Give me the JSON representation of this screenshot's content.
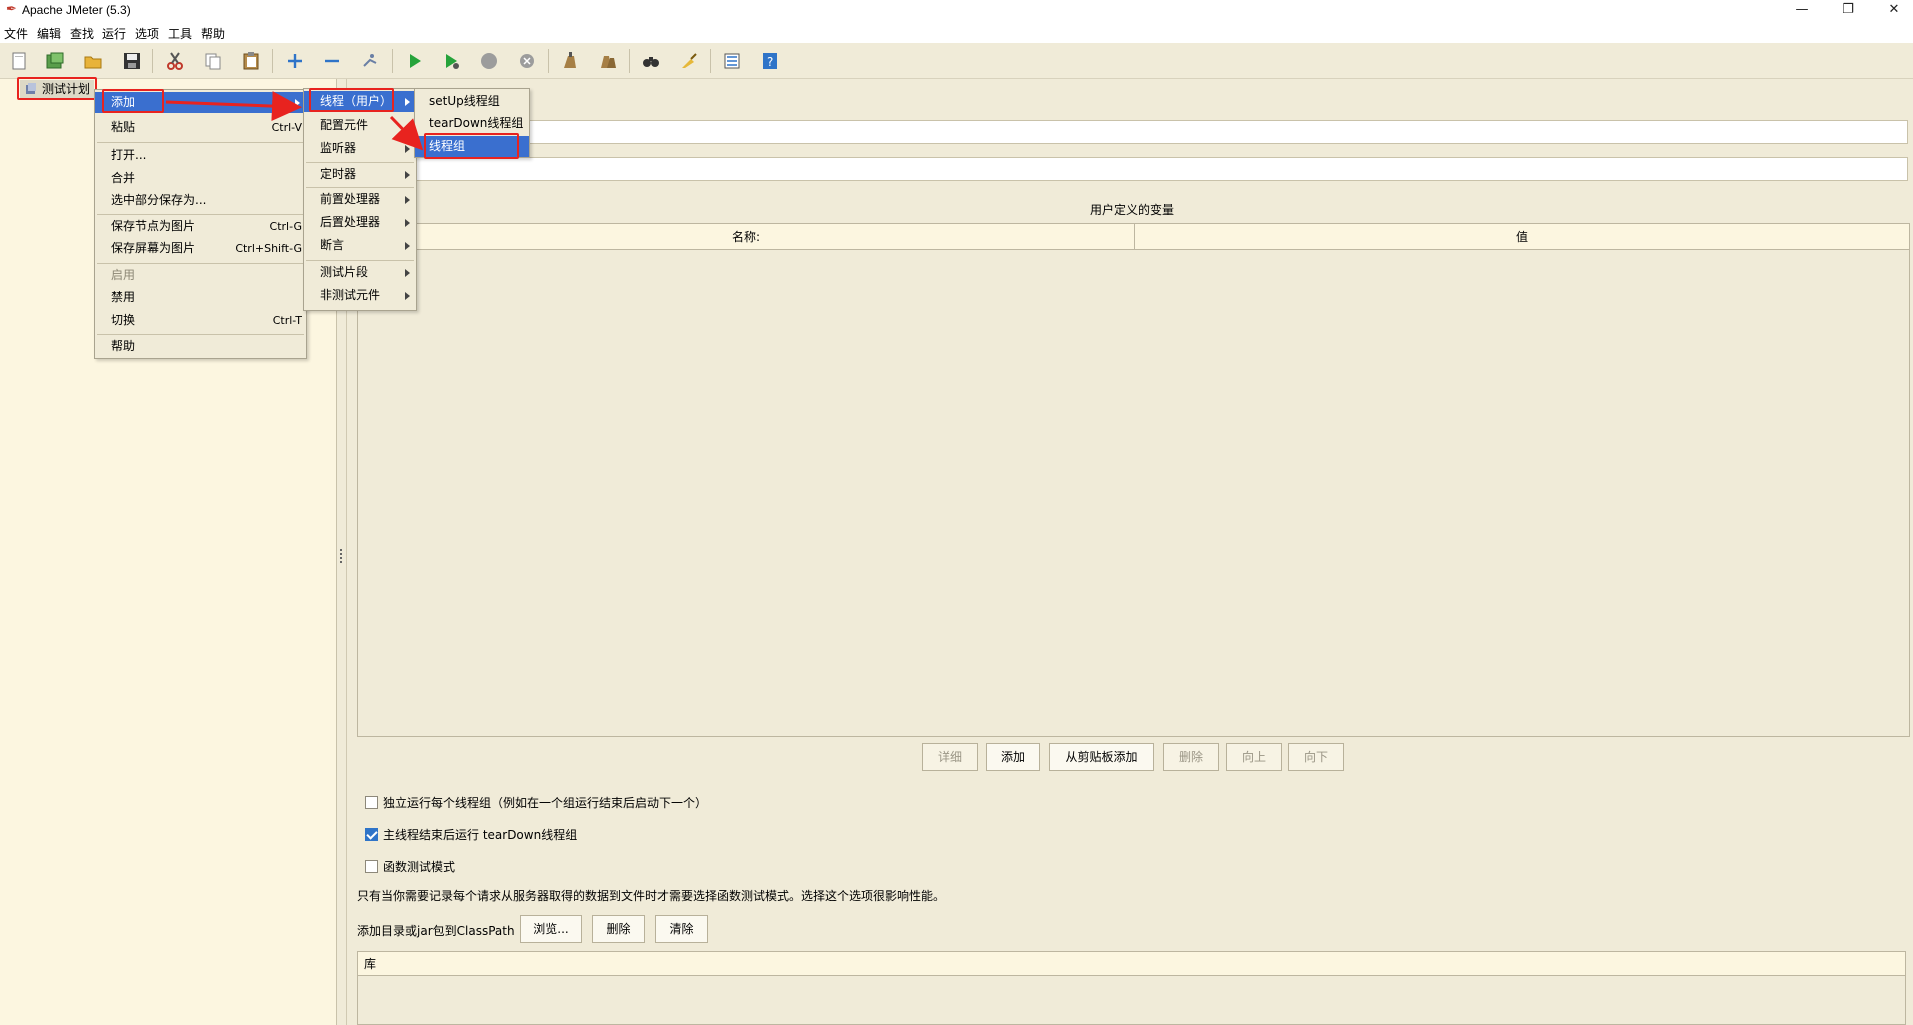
{
  "window": {
    "title": "Apache JMeter (5.3)",
    "controls": {
      "minimize": "—",
      "restore": "❐",
      "close": "✕"
    }
  },
  "menubar": [
    "文件",
    "编辑",
    "查找",
    "运行",
    "选项",
    "工具",
    "帮助"
  ],
  "toolbar_icons": [
    "new-icon",
    "templates-icon",
    "open-icon",
    "save-icon",
    "cut-icon",
    "copy-icon",
    "paste-icon",
    "expand-icon",
    "collapse-icon",
    "toggle-icon",
    "start-icon",
    "start-no-pause-icon",
    "stop-icon",
    "shutdown-icon",
    "clear-icon",
    "clear-all-icon",
    "search-icon",
    "reset-search-icon",
    "function-helper-icon",
    "help-icon"
  ],
  "tree": {
    "root_label": "测试计划"
  },
  "context_menu": {
    "items": [
      {
        "label": "添加",
        "shortcut": "",
        "submenu": true,
        "highlighted": true
      },
      {
        "label": "粘贴",
        "shortcut": "Ctrl-V"
      },
      {
        "label": "打开...",
        "shortcut": ""
      },
      {
        "label": "合并",
        "shortcut": ""
      },
      {
        "label": "选中部分保存为...",
        "shortcut": ""
      },
      {
        "label": "保存节点为图片",
        "shortcut": "Ctrl-G"
      },
      {
        "label": "保存屏幕为图片",
        "shortcut": "Ctrl+Shift-G"
      },
      {
        "label": "启用",
        "shortcut": "",
        "disabled": true
      },
      {
        "label": "禁用",
        "shortcut": ""
      },
      {
        "label": "切换",
        "shortcut": "Ctrl-T"
      },
      {
        "label": "帮助",
        "shortcut": ""
      }
    ]
  },
  "add_submenu": {
    "items": [
      "线程（用户）",
      "配置元件",
      "监听器",
      "定时器",
      "前置处理器",
      "后置处理器",
      "断言",
      "测试片段",
      "非测试元件"
    ]
  },
  "thread_submenu": {
    "items": [
      "setUp线程组",
      "tearDown线程组",
      "线程组"
    ]
  },
  "main": {
    "vars_title": "用户定义的变量",
    "vars_columns": {
      "name": "名称:",
      "value": "值"
    },
    "buttons": {
      "detail": "详细",
      "add": "添加",
      "add_clipboard": "从剪贴板添加",
      "delete": "删除",
      "up": "向上",
      "down": "向下"
    },
    "options": {
      "serialize": {
        "label": "独立运行每个线程组（例如在一个组运行结束后启动下一个）",
        "checked": false
      },
      "teardown": {
        "label": "主线程结束后运行 tearDown线程组",
        "checked": true
      },
      "functional": {
        "label": "函数测试模式",
        "checked": false
      }
    },
    "functional_note": "只有当你需要记录每个请求从服务器取得的数据到文件时才需要选择函数测试模式。选择这个选项很影响性能。",
    "classpath": {
      "label": "添加目录或jar包到ClassPath",
      "browse": "浏览...",
      "delete": "删除",
      "clear": "清除"
    },
    "lib_header": "库"
  }
}
